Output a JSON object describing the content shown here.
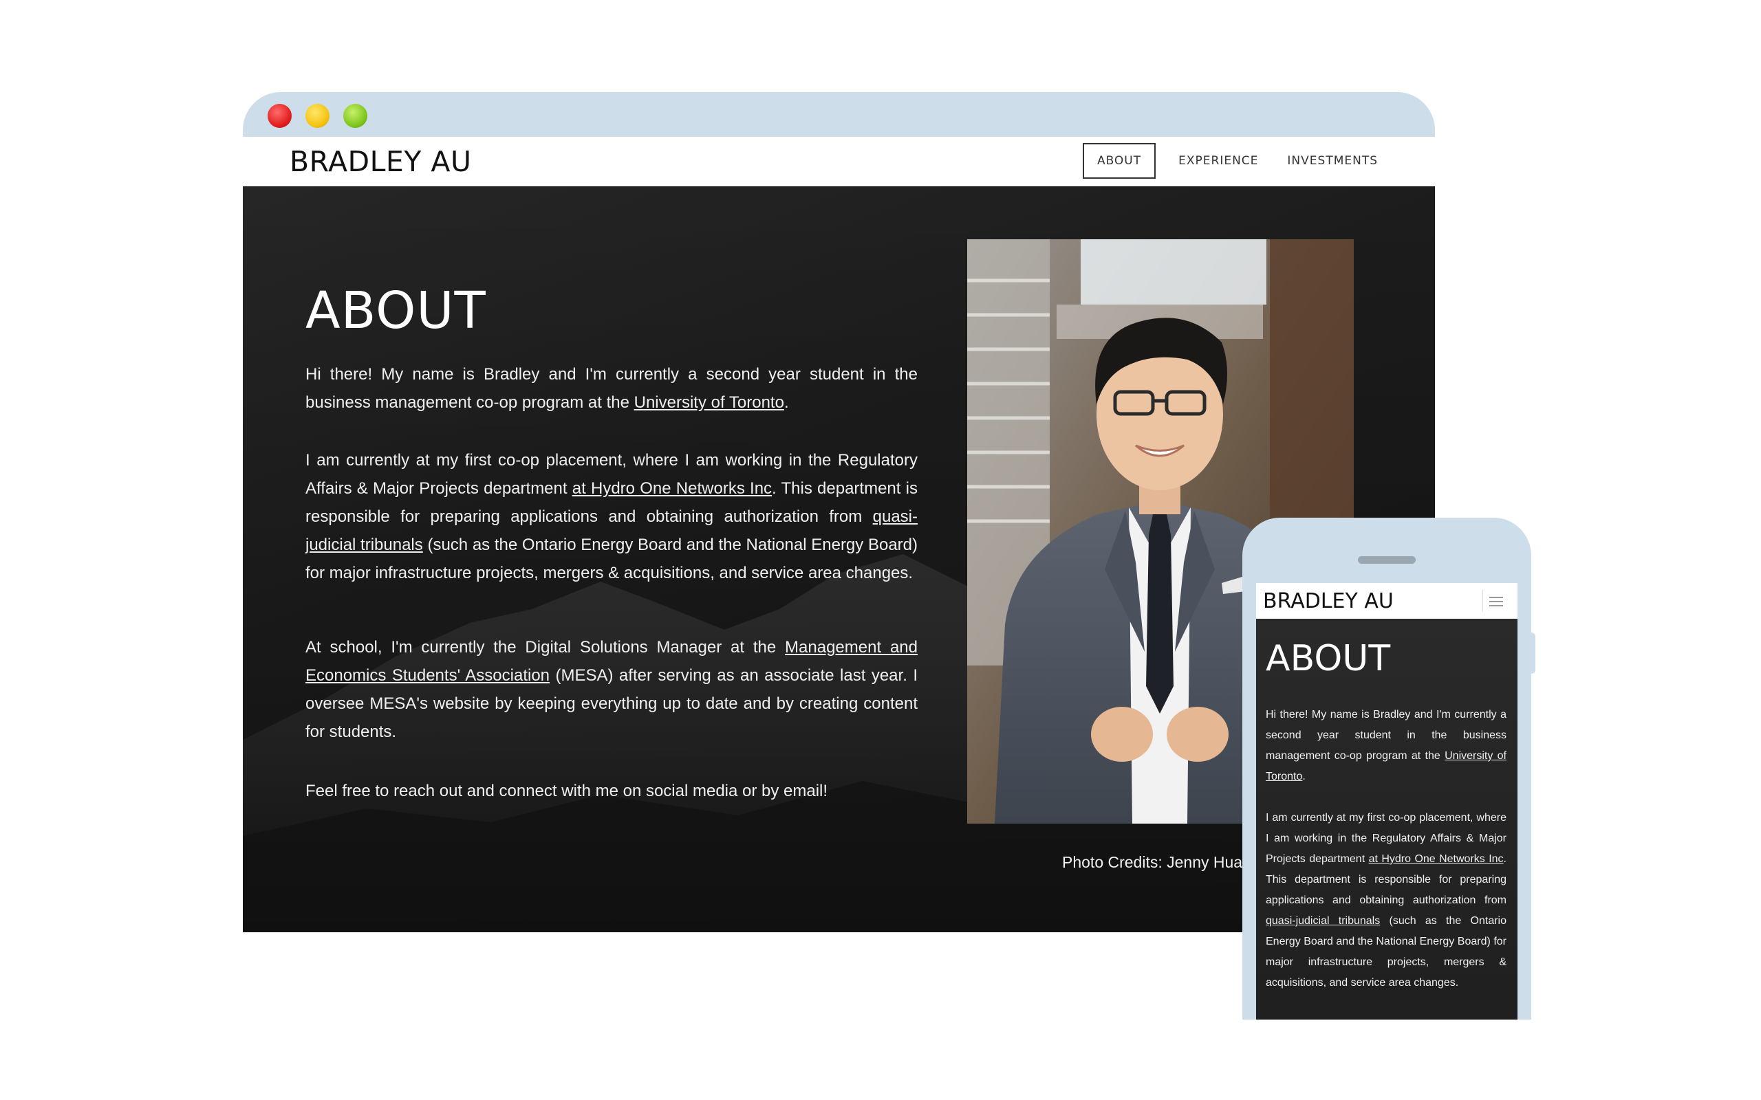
{
  "desktop": {
    "logo": "BRADLEY AU",
    "nav": [
      {
        "label": "ABOUT",
        "active": true
      },
      {
        "label": "EXPERIENCE",
        "active": false
      },
      {
        "label": "INVESTMENTS",
        "active": false
      }
    ],
    "title": "ABOUT",
    "p1": {
      "text": "Hi there! My name is Bradley and I'm currently a second year student in the business management co-op program at the ",
      "link": "University of Toronto",
      "after": "."
    },
    "p2": {
      "a": "I am currently at my first co-op placement, where I am working in the Regulatory Affairs & Major Projects department ",
      "link1": "at Hydro One Networks Inc",
      "b": ". This department is responsible for preparing applications and obtaining authorization from ",
      "link2": "quasi-judicial tribunals",
      "c": " (such as the Ontario Energy Board and the National Energy Board) for major infrastructure projects, mergers & acquisitions, and service area changes."
    },
    "p3": {
      "a": "At school, I'm currently the Digital Solutions Manager at the ",
      "link": "Management and Economics Students' Association",
      "b": " (MESA) after serving as an associate last year. I oversee MESA's website by keeping everything up to date and by creating content for students."
    },
    "p4": "Feel free to reach out and connect with me on social media or by email!",
    "photo_credits": "Photo Credits: Jenny Hua"
  },
  "mobile": {
    "logo": "BRADLEY AU",
    "title": "ABOUT",
    "p1": {
      "text": "Hi there! My name is Bradley and I'm currently a second year student in the business management co-op program at the ",
      "link": "University of Toronto",
      "after": "."
    },
    "p2": {
      "a": "I am currently at my first co-op placement, where I am working in the Regulatory Affairs & Major Projects department ",
      "link1": "at Hydro One Networks Inc",
      "b": ". This department is responsible for preparing applications and obtaining authorization from ",
      "link2": "quasi-judicial tribunals",
      "c": " (such as the Ontario Energy Board and the National Energy Board) for major infrastructure projects, mergers & acquisitions, and service area changes."
    }
  },
  "colors": {
    "frame": "#cddde9",
    "dark_bg": "#1c1c1c",
    "close_dot": "#e01d1d",
    "minimize_dot": "#f4c20d",
    "maximize_dot": "#7cc519"
  }
}
